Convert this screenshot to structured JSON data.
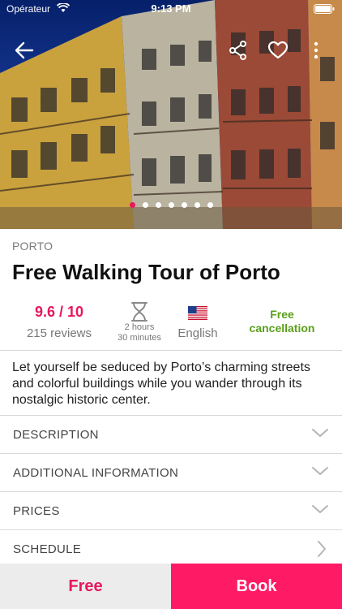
{
  "status_bar": {
    "carrier": "Opérateur",
    "time": "9:13 PM"
  },
  "header": {
    "back_icon": "arrow-left-icon",
    "share_icon": "share-icon",
    "favorite_icon": "heart-outline-icon",
    "more_icon": "more-vertical-icon"
  },
  "gallery": {
    "photo_count": 7,
    "active_index": 0
  },
  "tour": {
    "city": "PORTO",
    "title": "Free Walking Tour of Porto",
    "rating": "9.6 / 10",
    "reviews": "215 reviews",
    "duration_line1": "2 hours",
    "duration_line2": "30 minutes",
    "language": "English",
    "language_flag": "us-flag-icon",
    "cancellation_line1": "Free",
    "cancellation_line2": "cancellation",
    "summary": "Let yourself be seduced by Porto’s charming streets and colorful buildings while you wander through its nostalgic historic center."
  },
  "sections": [
    {
      "label": "DESCRIPTION",
      "icon": "chevron-down-icon"
    },
    {
      "label": "ADDITIONAL INFORMATION",
      "icon": "chevron-down-icon"
    },
    {
      "label": "PRICES",
      "icon": "chevron-down-icon"
    },
    {
      "label": "SCHEDULE",
      "icon": "chevron-right-icon"
    }
  ],
  "footer": {
    "price_label": "Free",
    "book_label": "Book"
  },
  "colors": {
    "accent": "#e8175d",
    "book": "#ff1a66",
    "success": "#5aa01a"
  }
}
